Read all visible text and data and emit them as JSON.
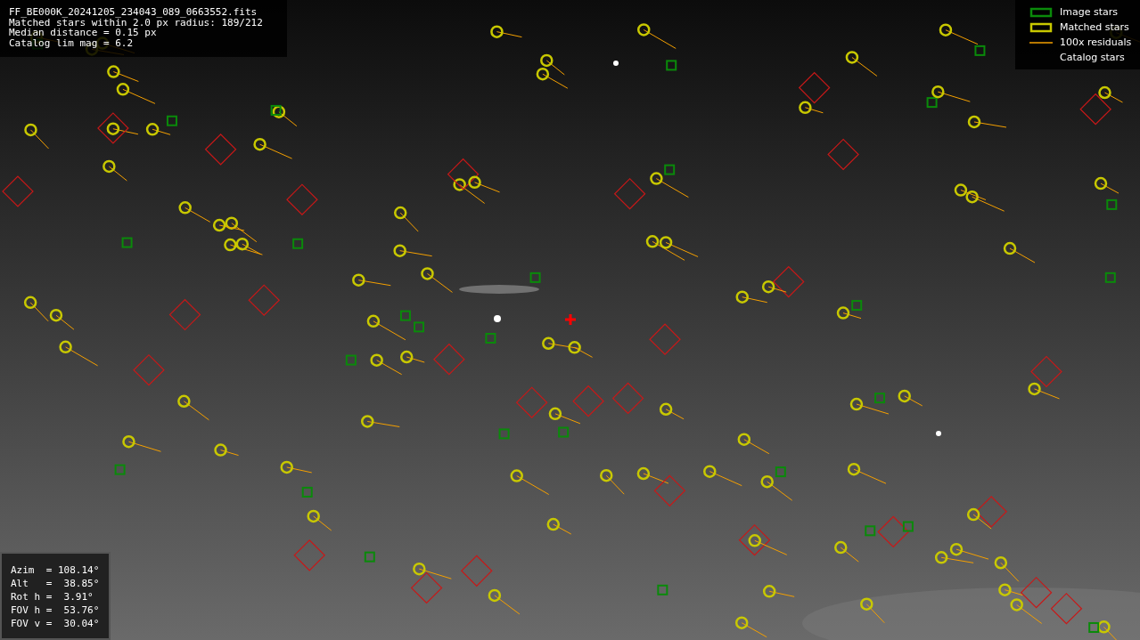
{
  "header": {
    "lines": [
      "FF_BE000K_20241205_234043_089_0663552.fits",
      "Matched stars within 2.0 px radius: 189/212",
      "Median distance = 0.15 px",
      "Catalog lim mag = 6.2"
    ]
  },
  "legend": [
    {
      "kind": "image",
      "label": "Image stars"
    },
    {
      "kind": "matched",
      "label": "Matched stars"
    },
    {
      "kind": "residual",
      "label": "100x residuals"
    },
    {
      "kind": "catalog",
      "label": "Catalog stars"
    }
  ],
  "pointing": {
    "lines": [
      "Azim  = 108.14°",
      "Alt   =  38.85°",
      "Rot h =  3.91°",
      "FOV h =  53.76°",
      "FOV v =  30.04°"
    ]
  }
}
